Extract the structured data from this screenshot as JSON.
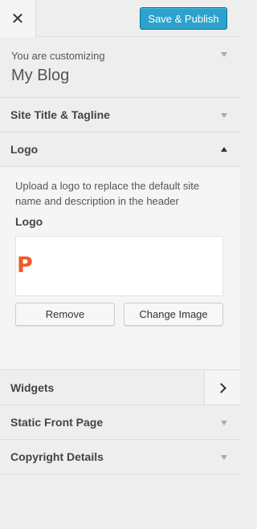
{
  "header": {
    "close_glyph": "✕",
    "save_label": "Save & Publish"
  },
  "customizing": {
    "label": "You are customizing",
    "site_name": "My Blog"
  },
  "sections": {
    "site_title": "Site Title & Tagline",
    "logo": "Logo",
    "widgets": "Widgets",
    "static_front_page": "Static Front Page",
    "copyright": "Copyright Details"
  },
  "logo_panel": {
    "description": "Upload a logo to replace the default site name and description in the header",
    "field_label": "Logo",
    "logo_letter": "P",
    "remove_label": "Remove",
    "change_label": "Change Image"
  },
  "colors": {
    "accent": "#2ea2cc",
    "logo": "#f05a28"
  }
}
